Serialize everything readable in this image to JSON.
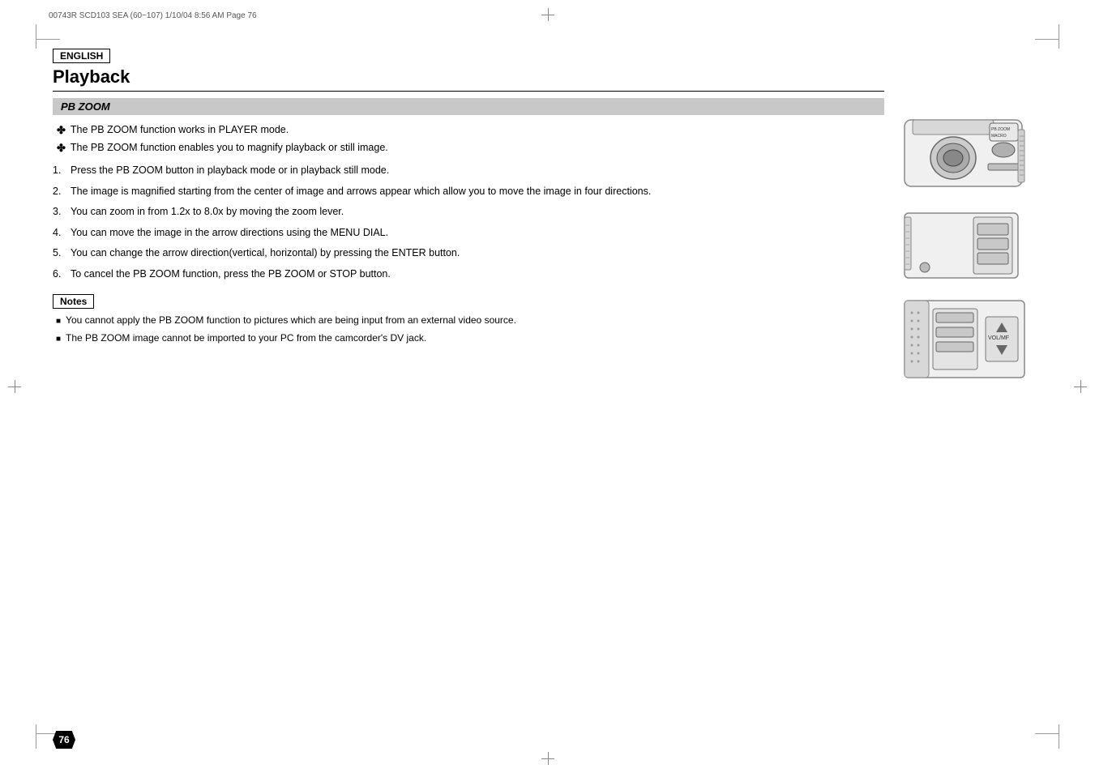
{
  "header": {
    "meta_text": "00743R SCD103 SEA (60~107)   1/10/04 8:56 AM   Page 76"
  },
  "language_badge": "ENGLISH",
  "page_title": "Playback",
  "section_title": "PB ZOOM",
  "cross_bullets": [
    "The PB ZOOM function works in PLAYER mode.",
    "The PB ZOOM function enables you to magnify playback or still image."
  ],
  "steps": [
    {
      "num": "1.",
      "text": "Press the PB ZOOM button in playback mode or in playback still mode."
    },
    {
      "num": "2.",
      "text": "The image is magnified starting from the center of image and arrows appear which allow you to move the image in four directions."
    },
    {
      "num": "3.",
      "text": "You can zoom in from 1.2x to 8.0x by moving the zoom lever."
    },
    {
      "num": "4.",
      "text": "You can move the image in the arrow directions using the MENU DIAL."
    },
    {
      "num": "5.",
      "text": "You can change the arrow direction(vertical, horizontal) by pressing the ENTER button."
    },
    {
      "num": "6.",
      "text": "To cancel the PB ZOOM function, press the PB ZOOM or STOP button."
    }
  ],
  "notes_label": "Notes",
  "notes": [
    "You cannot apply the PB ZOOM function to pictures which are being input from an external video source.",
    "The PB ZOOM image cannot be imported to your PC from the camcorder's DV jack."
  ],
  "page_number": "76",
  "images": {
    "img1_label": "PB ZOOM MACRO button area",
    "img2_label": "Camera side panel",
    "img3_label": "VOL/MF control"
  }
}
